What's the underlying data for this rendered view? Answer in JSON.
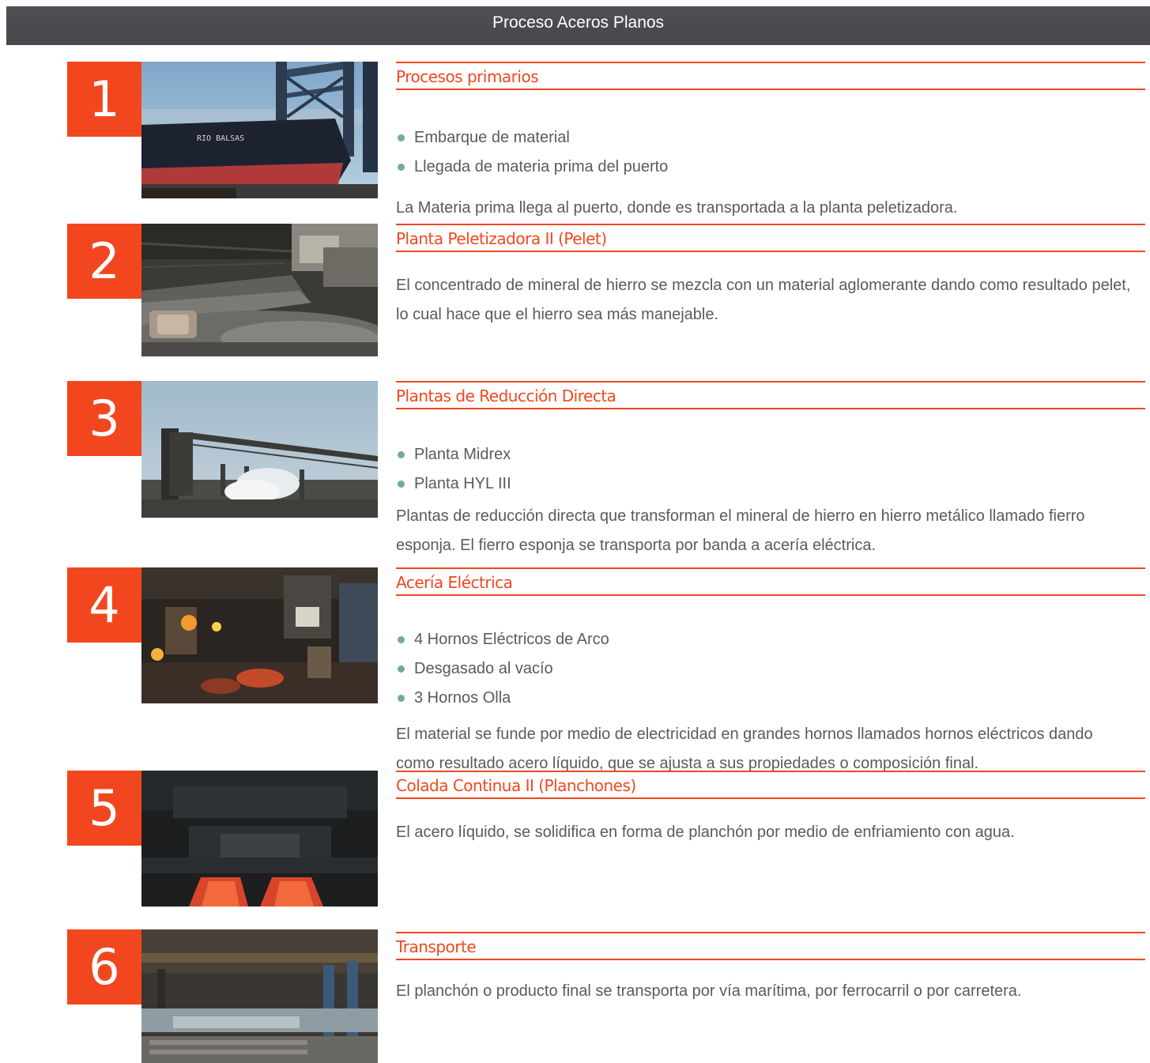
{
  "header": {
    "title": "Proceso Aceros Planos"
  },
  "steps": [
    {
      "number": "1",
      "image_subject": "ship-at-port",
      "ship_label": "RIO BALSAS",
      "title": "Procesos primarios",
      "bullets": [
        "Embarque de material",
        "Llegada de materia prima del puerto"
      ],
      "description": "La Materia prima llega al puerto, donde es transportada a la planta peletizadora."
    },
    {
      "number": "2",
      "image_subject": "pellet-conveyor",
      "title": "Planta Peletizadora II (Pelet)",
      "bullets": [],
      "description": "El concentrado de mineral de hierro se mezcla con un material aglomerante dando como resultado pelet, lo cual hace que el hierro sea más manejable."
    },
    {
      "number": "3",
      "image_subject": "direct-reduction-plant",
      "title": "Plantas de Reducción Directa",
      "bullets": [
        "Planta Midrex",
        "Planta HYL III"
      ],
      "description": "Plantas de reducción directa que transforman el mineral de hierro en hierro metálico llamado fierro esponja. El fierro esponja se transporta por banda a acería eléctrica."
    },
    {
      "number": "4",
      "image_subject": "electric-steel-mill",
      "title": "Acería Eléctrica",
      "bullets": [
        "4 Hornos Eléctricos de Arco",
        "Desgasado al vacío",
        "3 Hornos Olla"
      ],
      "description": "El material se funde por medio de electricidad en grandes hornos llamados hornos eléctricos dando como resultado acero líquido, que se ajusta a sus propiedades o composición final."
    },
    {
      "number": "5",
      "image_subject": "continuous-casting",
      "title": "Colada Continua II (Planchones)",
      "bullets": [],
      "description": "El acero líquido, se solidifica en forma de planchón por medio de enfriamiento con agua."
    },
    {
      "number": "6",
      "image_subject": "slab-warehouse-transport",
      "title": "Transporte",
      "bullets": [],
      "description": "El planchón o producto final se transporta por vía marítima, por ferrocarril o por carretera."
    }
  ],
  "colors": {
    "accent": "#f2471e",
    "header_bg": "#4a4c50",
    "bullet": "#6fae8f",
    "text": "#5a5a5a"
  }
}
